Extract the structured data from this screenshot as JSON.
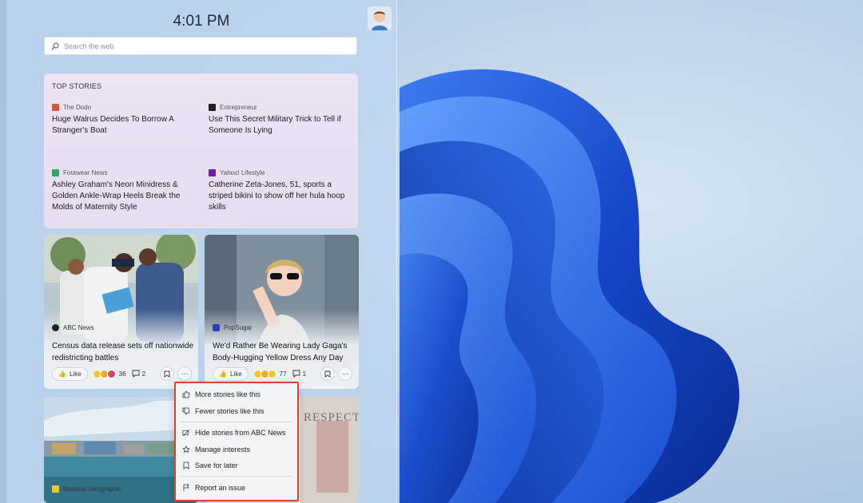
{
  "clock": "4:01 PM",
  "search": {
    "placeholder": "Search the web"
  },
  "top_stories": {
    "title": "TOP STORIES",
    "stories": [
      {
        "source": "The Dodo",
        "headline": "Huge Walrus Decides To Borrow A Stranger's Boat",
        "icon_color": "#d9553a"
      },
      {
        "source": "Entrepreneur",
        "headline": "Use This Secret Military Trick to Tell if Someone Is Lying",
        "icon_color": "#222222"
      },
      {
        "source": "Footwear News",
        "headline": "Ashley Graham's Neon Minidress & Golden Ankle-Wrap Heels Break the Molds of Maternity Style",
        "icon_color": "#3aa36a"
      },
      {
        "source": "Yahoo! Lifestyle",
        "headline": "Catherine Zeta-Jones, 51, sports a striped bikini to show off her hula hoop skills",
        "icon_color": "#6b1fb1"
      }
    ]
  },
  "cards": [
    {
      "source": "ABC News",
      "headline": "Census data release sets off nationwide redistricting battles",
      "like": "Like",
      "reactions": "36",
      "comments": "2",
      "icon_color": "#222222"
    },
    {
      "source": "PopSugar",
      "headline": "We'd Rather Be Wearing Lady Gaga's Body-Hugging Yellow Dress Any Day",
      "like": "Like",
      "reactions": "77",
      "comments": "1",
      "icon_color": "#2a3fbf"
    },
    {
      "source": "National Geographic",
      "icon_color": "#f2c230"
    },
    {
      "banner_text": "RESPECT"
    }
  ],
  "context_menu": {
    "items": [
      {
        "label": "More stories like this",
        "icon": "thumbs-up-icon"
      },
      {
        "label": "Fewer stories like this",
        "icon": "thumbs-down-icon"
      },
      {
        "label": "Hide stories from ABC News",
        "icon": "hide-icon"
      },
      {
        "label": "Manage interests",
        "icon": "star-gear-icon"
      },
      {
        "label": "Save for later",
        "icon": "bookmark-icon"
      },
      {
        "label": "Report an issue",
        "icon": "flag-icon"
      }
    ],
    "highlight_color": "#d9452b"
  }
}
